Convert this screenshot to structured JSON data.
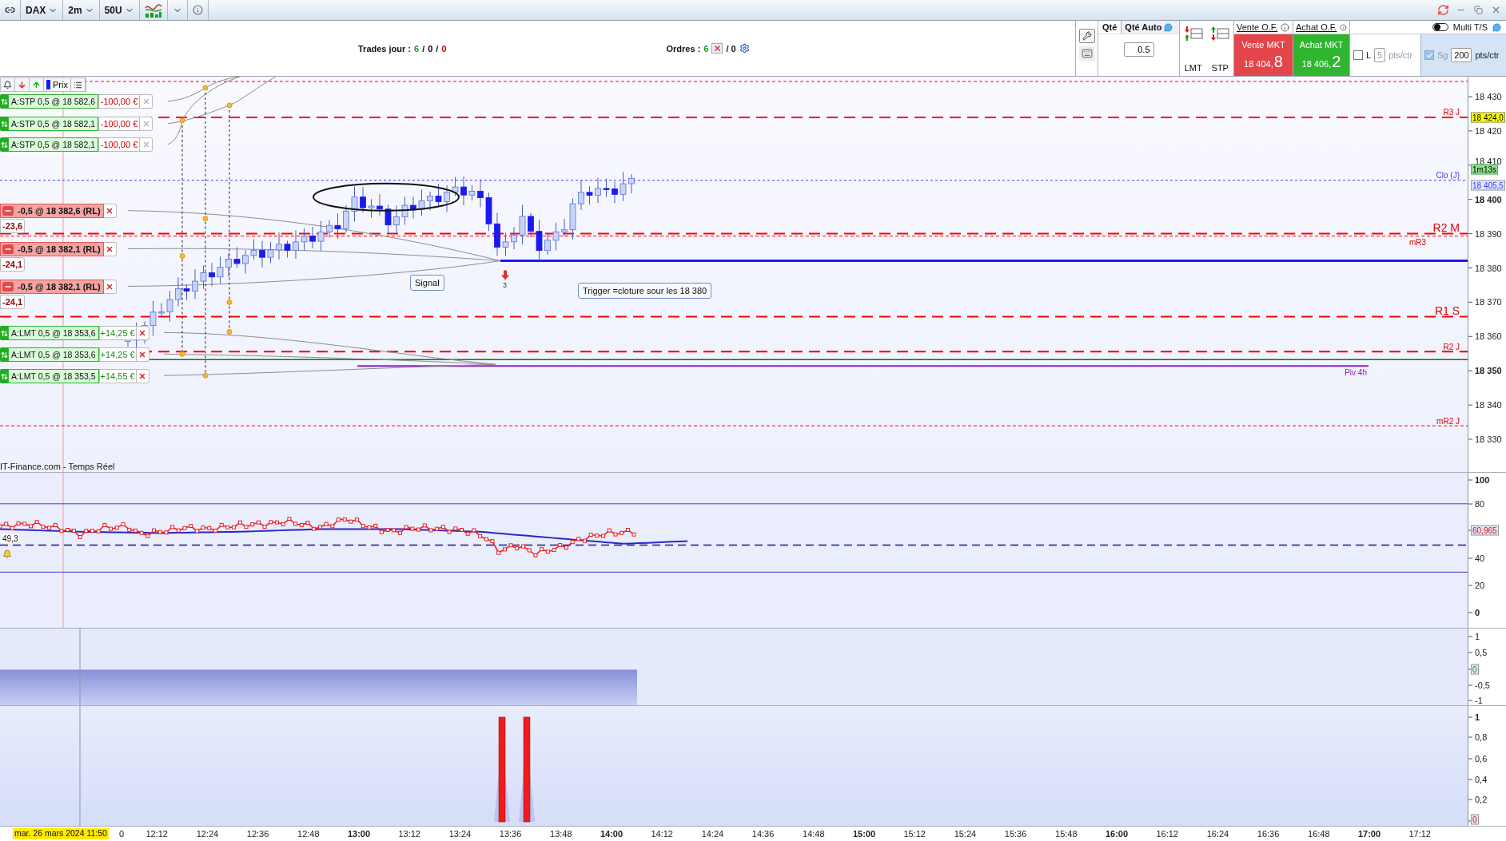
{
  "toolbar": {
    "symbol": "DAX",
    "timeframe": "2m",
    "units": "50U"
  },
  "header": {
    "trades": {
      "label": "Trades jour :",
      "separator": "/",
      "counts": [
        {
          "text": "6",
          "color": "#1e9a1e"
        },
        {
          "text": "0",
          "color": "#000000"
        },
        {
          "text": "0",
          "color": "#cc0000"
        }
      ]
    },
    "orders": {
      "label": "Ordres :",
      "count": "6",
      "rest": "/ 0"
    }
  },
  "ticket": {
    "qty_label": "Qté",
    "qty_auto": "Qté Auto",
    "qty": "0.5",
    "order_types": [
      "LMT",
      "STP"
    ],
    "sell": {
      "title": "Vente O.F.",
      "label": "Vente MKT",
      "price": "18 404,",
      "price_last": "8"
    },
    "buy": {
      "title": "Achat O.F.",
      "label": "Achat MKT",
      "price": "18 406,",
      "price_last": "2"
    },
    "multi_ts": {
      "label": "Multi T/S",
      "on": false
    },
    "loss": {
      "label": "L",
      "checked": false,
      "value": "5",
      "unit": "pts/ctr"
    },
    "gain": {
      "label": "Sg",
      "checked": true,
      "value": "200",
      "unit": "pts/ctr"
    }
  },
  "chart_tools": {
    "price_label": "Prix"
  },
  "orders": [
    {
      "kind": "stop",
      "text": "A:STP 0,5 @ 18 582,6",
      "pnl": "-100,00 €"
    },
    {
      "kind": "stop",
      "text": "A:STP 0,5 @ 18 582,1",
      "pnl": "-100,00 €"
    },
    {
      "kind": "stop",
      "text": "A:STP 0,5 @ 18 582,1",
      "pnl": "-100,00 €"
    },
    {
      "kind": "limit",
      "text": "A:LMT 0,5 @ 18 353,6",
      "pnl": "+14,25 €"
    },
    {
      "kind": "limit",
      "text": "A:LMT 0,5 @ 18 353,6",
      "pnl": "+14,25 €"
    },
    {
      "kind": "limit",
      "text": "A:LMT 0,5 @ 18 353,5",
      "pnl": "+14,55 €"
    }
  ],
  "positions": [
    {
      "text": "-0,5 @ 18 382,6 (RL)",
      "pnl": "-23,6"
    },
    {
      "text": "-0,5 @ 18 382,1 (RL)",
      "pnl": "-24,1"
    },
    {
      "text": "-0,5 @ 18 382,1 (RL)",
      "pnl": "-24,1"
    }
  ],
  "levels": [
    {
      "kind": "daily",
      "label": "R3 J"
    },
    {
      "kind": "close",
      "label": "Clo (J)"
    },
    {
      "kind": "monthly",
      "label": "R2 M"
    },
    {
      "kind": "minor",
      "label": "mR3"
    },
    {
      "kind": "weekly",
      "label": "R1 S"
    },
    {
      "kind": "daily",
      "label": "R2 J"
    },
    {
      "kind": "pivot",
      "label": "Piv 4h"
    },
    {
      "kind": "minor",
      "label": "mR2 J"
    }
  ],
  "annotations": {
    "signal": "Signal",
    "trigger": "Trigger =cloture sour les 18 380",
    "marker": "3"
  },
  "source": "IT-Finance.com - Temps Réel",
  "price_axis": {
    "ticks": [
      {
        "text": "18 430",
        "major": false
      },
      {
        "text": "18 420",
        "major": false
      },
      {
        "text": "18 410",
        "major": false
      },
      {
        "text": "18 400",
        "major": true
      },
      {
        "text": "18 390",
        "major": false
      },
      {
        "text": "18 380",
        "major": false
      },
      {
        "text": "18 370",
        "major": false
      },
      {
        "text": "18 360",
        "major": false
      },
      {
        "text": "18 350",
        "major": true
      },
      {
        "text": "18 340",
        "major": false
      },
      {
        "text": "18 330",
        "major": false
      }
    ],
    "tags": [
      {
        "kind": "last",
        "text": "18 424,0"
      },
      {
        "kind": "timer",
        "text": "1m13s"
      },
      {
        "kind": "close",
        "text": "18 405,5"
      }
    ]
  },
  "rsi": {
    "value": "49,3",
    "tag": "60,965",
    "ticks": [
      {
        "text": "100",
        "major": true
      },
      {
        "text": "80",
        "major": false
      },
      {
        "text": "40",
        "major": false
      },
      {
        "text": "20",
        "major": false
      },
      {
        "text": "0",
        "major": true
      }
    ]
  },
  "osc1": {
    "tag": "0",
    "ticks": [
      {
        "text": "1",
        "major": false
      },
      {
        "text": "0,5",
        "major": false
      },
      {
        "text": "-0,5",
        "major": false
      },
      {
        "text": "-1",
        "major": false
      }
    ]
  },
  "osc2": {
    "tag": "0",
    "ticks": [
      {
        "text": "1",
        "major": true
      },
      {
        "text": "0,8",
        "major": false
      },
      {
        "text": "0,6",
        "major": false
      },
      {
        "text": "0,4",
        "major": false
      },
      {
        "text": "0,2",
        "major": false
      }
    ]
  },
  "time_axis": {
    "date": "mar. 26 mars 2024 11:50",
    "ticks": [
      {
        "text": "0",
        "major": false
      },
      {
        "text": "12:12",
        "major": false
      },
      {
        "text": "12:24",
        "major": false
      },
      {
        "text": "12:36",
        "major": false
      },
      {
        "text": "12:48",
        "major": false
      },
      {
        "text": "13:00",
        "major": true
      },
      {
        "text": "13:12",
        "major": false
      },
      {
        "text": "13:24",
        "major": false
      },
      {
        "text": "13:36",
        "major": false
      },
      {
        "text": "13:48",
        "major": false
      },
      {
        "text": "14:00",
        "major": true
      },
      {
        "text": "14:12",
        "major": false
      },
      {
        "text": "14:24",
        "major": false
      },
      {
        "text": "14:36",
        "major": false
      },
      {
        "text": "14:48",
        "major": false
      },
      {
        "text": "15:00",
        "major": true
      },
      {
        "text": "15:12",
        "major": false
      },
      {
        "text": "15:24",
        "major": false
      },
      {
        "text": "15:36",
        "major": false
      },
      {
        "text": "15:48",
        "major": false
      },
      {
        "text": "16:00",
        "major": true
      },
      {
        "text": "16:12",
        "major": false
      },
      {
        "text": "16:24",
        "major": false
      },
      {
        "text": "16:36",
        "major": false
      },
      {
        "text": "16:48",
        "major": false
      },
      {
        "text": "17:00",
        "major": true
      },
      {
        "text": "17:12",
        "major": false
      }
    ]
  }
}
